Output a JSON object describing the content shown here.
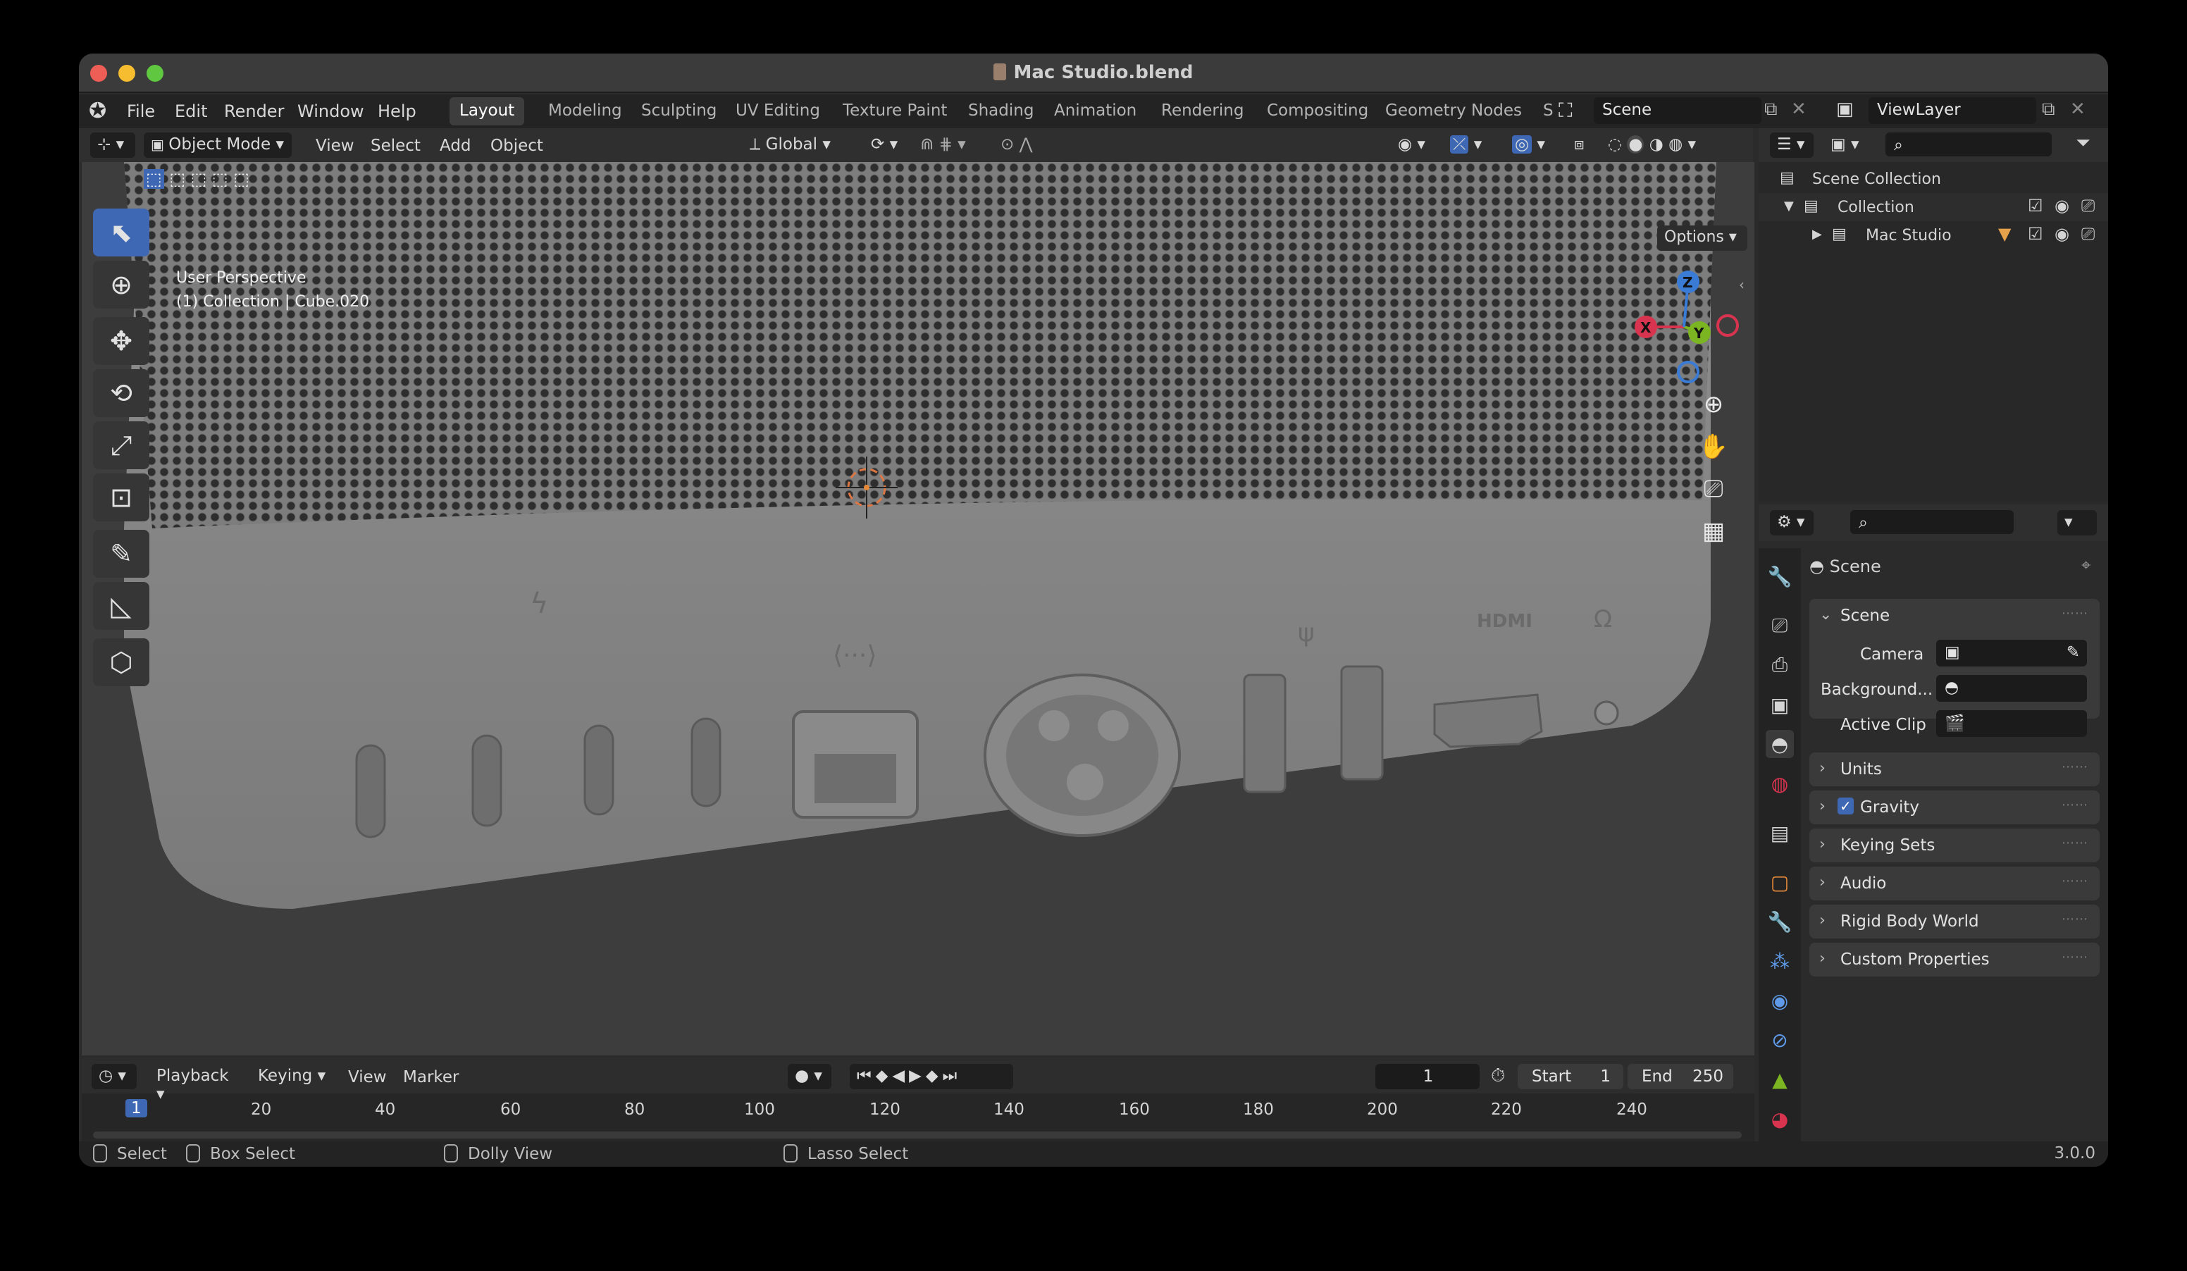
{
  "window": {
    "title": "Mac Studio.blend"
  },
  "menu": [
    "File",
    "Edit",
    "Render",
    "Window",
    "Help"
  ],
  "workspaces": [
    "Layout",
    "Modeling",
    "Sculpting",
    "UV Editing",
    "Texture Paint",
    "Shading",
    "Animation",
    "Rendering",
    "Compositing",
    "Geometry Nodes"
  ],
  "workspace_overflow": "S",
  "scene_field": "Scene",
  "viewlayer_field": "ViewLayer",
  "header": {
    "mode": "Object Mode",
    "view": "View",
    "select": "Select",
    "add": "Add",
    "object": "Object",
    "transform": "Global"
  },
  "viewport": {
    "options": "Options",
    "perspective": "User Perspective",
    "collection_info": "(1) Collection | Cube.020",
    "gizmo": {
      "x": "X",
      "y": "Y",
      "z": "Z"
    },
    "port_label_hdmi": "HDMI"
  },
  "outliner": {
    "items": [
      "Scene Collection",
      "Collection",
      "Mac Studio"
    ]
  },
  "properties": {
    "header": "Scene",
    "section": "Scene",
    "camera_label": "Camera",
    "background_label": "Background...",
    "active_clip_label": "Active Clip",
    "panels": [
      "Units",
      "Gravity",
      "Keying Sets",
      "Audio",
      "Rigid Body World",
      "Custom Properties"
    ]
  },
  "timeline": {
    "playback": "Playback",
    "keying": "Keying",
    "view": "View",
    "marker": "Marker",
    "current_frame": "1",
    "start_label": "Start",
    "start": "1",
    "end_label": "End",
    "end": "250",
    "playhead": "1",
    "ruler": [
      "20",
      "40",
      "60",
      "80",
      "100",
      "120",
      "140",
      "160",
      "180",
      "200",
      "220",
      "240"
    ]
  },
  "status": {
    "select": "Select",
    "box_select": "Box Select",
    "dolly_view": "Dolly View",
    "lasso_select": "Lasso Select",
    "version": "3.0.0"
  },
  "colors": {
    "accent": "#3f68b4",
    "close": "#ee5e57",
    "minimize": "#f5bd2f",
    "zoom": "#5fc840",
    "axis_x": "#d9344f",
    "axis_y": "#7bb521",
    "axis_z": "#3a7bd5"
  }
}
